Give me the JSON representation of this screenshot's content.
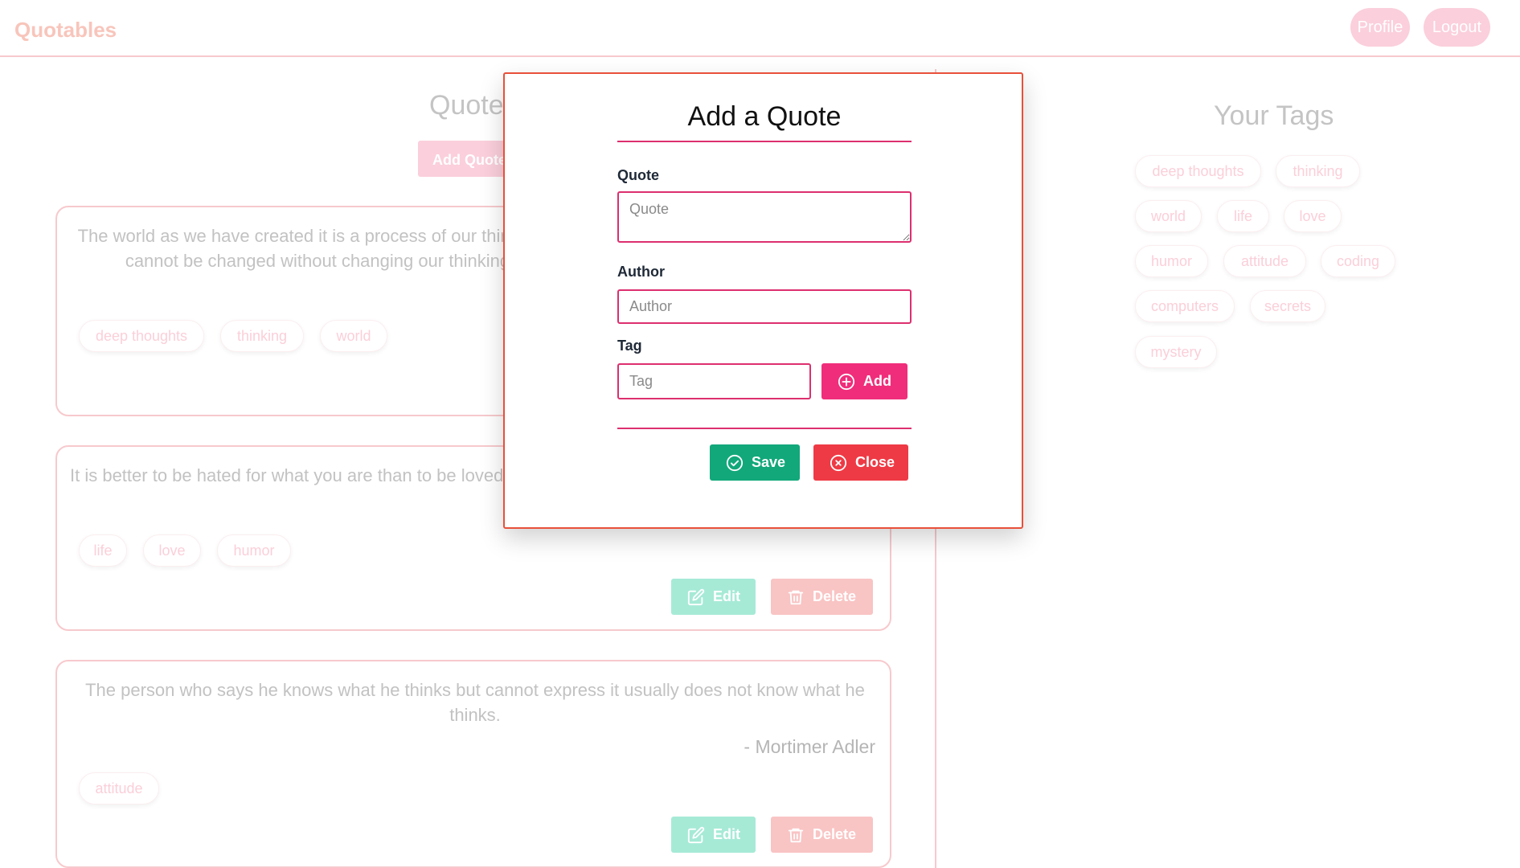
{
  "header": {
    "brand": "Quotables",
    "profile_label": "Profile",
    "logout_label": "Logout"
  },
  "quotes": {
    "title": "Quotes",
    "add_button_label": "Add Quote",
    "cards": [
      {
        "text": "The world as we have created it is a process of our thinking. It cannot be changed without changing our thinking.",
        "author": "",
        "tags": [
          "deep thoughts",
          "thinking",
          "world"
        ]
      },
      {
        "text": "It is better to be hated for what you are than to be loved for what you are not.",
        "author": "",
        "tags": [
          "life",
          "love",
          "humor"
        ],
        "edit_label": "Edit",
        "delete_label": "Delete"
      },
      {
        "text": "The person who says he knows what he thinks but cannot express it usually does not know what he thinks.",
        "author": "- Mortimer Adler",
        "tags": [
          "attitude"
        ],
        "edit_label": "Edit",
        "delete_label": "Delete"
      }
    ]
  },
  "your_tags": {
    "title": "Your Tags",
    "tags": [
      "deep thoughts",
      "thinking",
      "world",
      "life",
      "love",
      "humor",
      "attitude",
      "coding",
      "computers",
      "secrets",
      "mystery"
    ]
  },
  "modal": {
    "title": "Add a Quote",
    "quote_label": "Quote",
    "quote_placeholder": "Quote",
    "author_label": "Author",
    "author_placeholder": "Author",
    "tag_label": "Tag",
    "tag_placeholder": "Tag",
    "add_label": "Add",
    "save_label": "Save",
    "close_label": "Close"
  },
  "icons": {
    "add": "plus-circle-icon",
    "save": "check-circle-icon",
    "close": "x-circle-icon",
    "edit": "edit-icon",
    "delete": "trash-icon"
  },
  "colors": {
    "accent_pink": "#dd2f6e",
    "add_button": "#f02d7a",
    "save_green": "#12a87a",
    "close_red": "#ee3a45",
    "modal_border": "#e8503a"
  }
}
